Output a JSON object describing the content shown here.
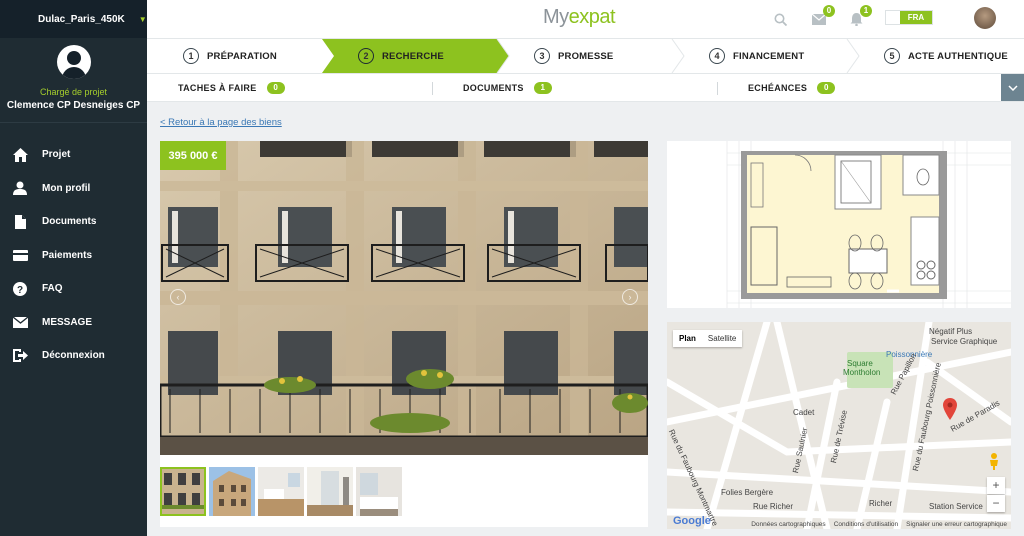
{
  "sidebar": {
    "project": "Dulac_Paris_450K",
    "role": "Chargé de projet",
    "user_name": "Clemence CP Desneiges CP",
    "items": [
      {
        "label": "Projet",
        "icon": "home-icon"
      },
      {
        "label": "Mon profil",
        "icon": "user-icon"
      },
      {
        "label": "Documents",
        "icon": "document-icon"
      },
      {
        "label": "Paiements",
        "icon": "card-icon"
      },
      {
        "label": "FAQ",
        "icon": "question-icon"
      },
      {
        "label": "MESSAGE",
        "icon": "envelope-icon"
      },
      {
        "label": "Déconnexion",
        "icon": "logout-icon"
      }
    ]
  },
  "header": {
    "logo_main": "My",
    "logo_accent": "expat",
    "messages_count": "0",
    "notifications_count": "1",
    "language": "FRA"
  },
  "steps": [
    {
      "number": "1",
      "label": "PRÉPARATION"
    },
    {
      "number": "2",
      "label": "RECHERCHE"
    },
    {
      "number": "3",
      "label": "PROMESSE"
    },
    {
      "number": "4",
      "label": "FINANCEMENT"
    },
    {
      "number": "5",
      "label": "ACTE AUTHENTIQUE"
    }
  ],
  "tabs": [
    {
      "label": "TACHES À FAIRE",
      "count": "0"
    },
    {
      "label": "DOCUMENTS",
      "count": "1"
    },
    {
      "label": "ECHÉANCES",
      "count": "0"
    }
  ],
  "content": {
    "back_link": "< Retour à la page des biens",
    "price": "395 000 €"
  },
  "map": {
    "toggle_plan": "Plan",
    "toggle_satellite": "Satellite",
    "labels": [
      "Négatif Plus",
      "Service Graphique",
      "Poissonnière",
      "Square",
      "Montholon",
      "Cadet",
      "Rue Papillon",
      "Rue de Paradis",
      "Rue Saulnier",
      "Rue de Trévise",
      "Rue du Faubourg Poissonnière",
      "Rue du Faubourg Montmartre",
      "Folies Bergère",
      "Rue Richer",
      "Richer",
      "Station Service"
    ],
    "footer": [
      "Données cartographiques",
      "Conditions d'utilisation",
      "Signaler une erreur cartographique"
    ],
    "google": "Google",
    "zoom_in": "+",
    "zoom_out": "−"
  },
  "colors": {
    "accent": "#8dc21f",
    "sidebar": "#1f2c33"
  }
}
